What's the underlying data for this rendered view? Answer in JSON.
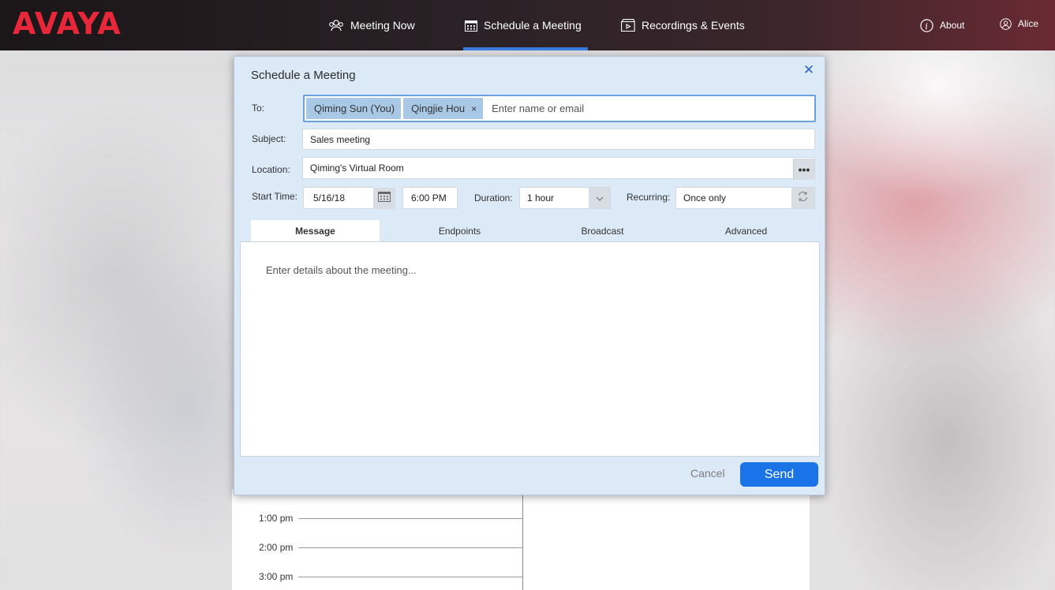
{
  "brand": {
    "logo": "AVAYA",
    "accent": "#e8283a",
    "active_tab_color": "#3a7be0"
  },
  "nav": {
    "meeting_now": "Meeting Now",
    "schedule_meeting": "Schedule a Meeting",
    "recordings_events": "Recordings & Events",
    "about": "About",
    "user": "Alice"
  },
  "dialog": {
    "title": "Schedule a Meeting",
    "to_label": "To:",
    "recipients": [
      "Qiming Sun (You)",
      "Qingjie Hou"
    ],
    "to_placeholder": "Enter name or email",
    "subject_label": "Subject:",
    "subject_value": "Sales meeting",
    "location_label": "Location:",
    "location_value": "Qiming's Virtual Room",
    "start_time_label": "Start Time:",
    "start_date": "5/16/18",
    "start_time": "6:00 PM",
    "duration_label": "Duration:",
    "duration_value": "1 hour",
    "recurring_label": "Recurring:",
    "recurring_value": "Once only",
    "tabs": [
      "Message",
      "Endpoints",
      "Broadcast",
      "Advanced"
    ],
    "message_placeholder": "Enter details about the meeting...",
    "cancel": "Cancel",
    "send": "Send"
  },
  "calendar": {
    "times": [
      "1:00 pm",
      "2:00 pm",
      "3:00 pm"
    ]
  }
}
